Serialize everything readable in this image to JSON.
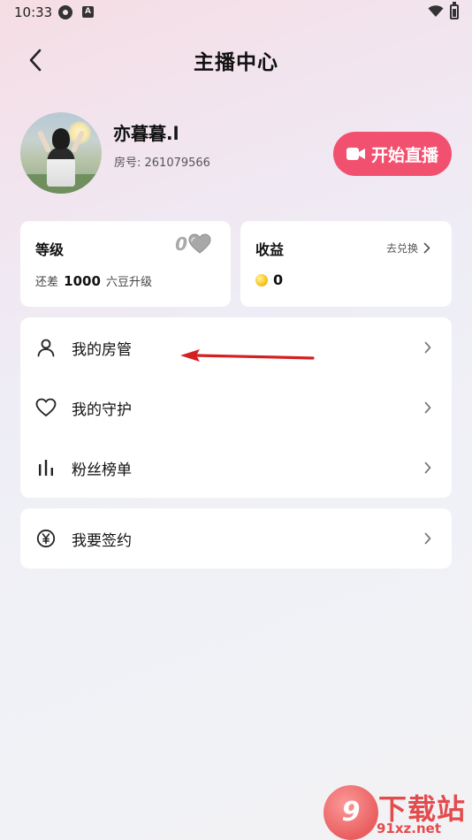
{
  "status_bar": {
    "time": "10:33",
    "badge_letter": "A"
  },
  "header": {
    "title": "主播中心"
  },
  "profile": {
    "name": "亦暮暮.l",
    "room_label": "房号: ",
    "room_number": "261079566",
    "start_live_label": "开始直播"
  },
  "level_card": {
    "title": "等级",
    "level_value": "0",
    "sub_prefix": "还差",
    "sub_amount": "1000",
    "sub_suffix": "六豆升级"
  },
  "earnings_card": {
    "title": "收益",
    "redeem_label": "去兑换",
    "value": "0"
  },
  "menu": {
    "items": [
      {
        "label": "我的房管",
        "icon": "person-icon"
      },
      {
        "label": "我的守护",
        "icon": "heart-icon"
      },
      {
        "label": "粉丝榜单",
        "icon": "bar-chart-icon"
      }
    ],
    "sign": {
      "label": "我要签约",
      "icon": "yen-circle-icon"
    }
  },
  "watermark": {
    "logo_text": "9",
    "title": "下载站",
    "url": "91xz.net"
  },
  "colors": {
    "accent": "#f2506f",
    "annotation_arrow": "#d42020",
    "watermark": "#e23b3b"
  }
}
